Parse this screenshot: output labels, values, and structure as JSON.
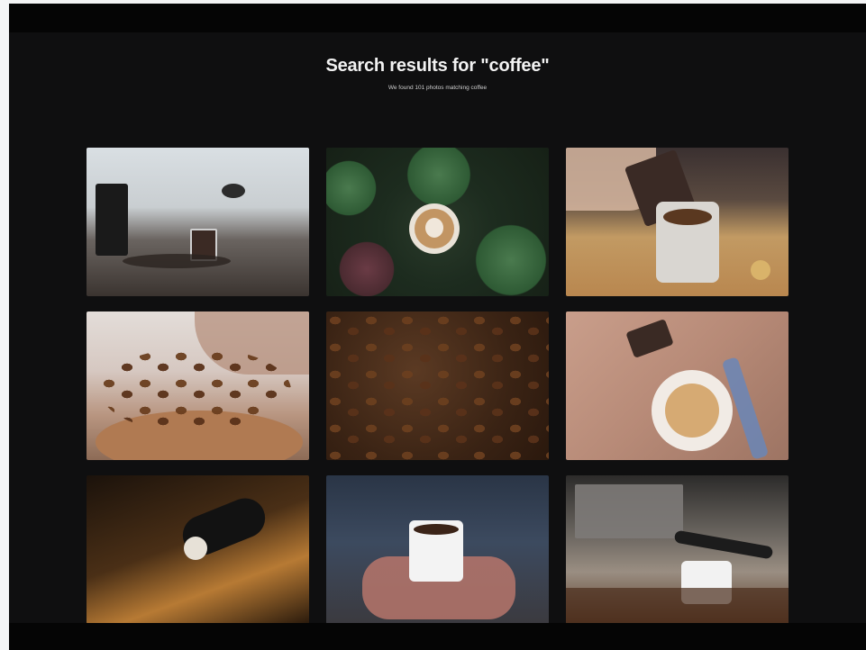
{
  "header": {
    "title": "Search results for \"coffee\"",
    "subtitle": "We found 101 photos matching coffee"
  },
  "results": [
    {
      "icon": "coffee-pour-over-photo"
    },
    {
      "icon": "latte-succulents-photo"
    },
    {
      "icon": "pouring-coffee-photo"
    },
    {
      "icon": "coffee-beans-closeup-photo"
    },
    {
      "icon": "roasted-beans-texture-photo"
    },
    {
      "icon": "latte-on-table-photo"
    },
    {
      "icon": "wall-light-photo"
    },
    {
      "icon": "hands-holding-mug-photo"
    },
    {
      "icon": "espresso-machine-photo"
    }
  ]
}
